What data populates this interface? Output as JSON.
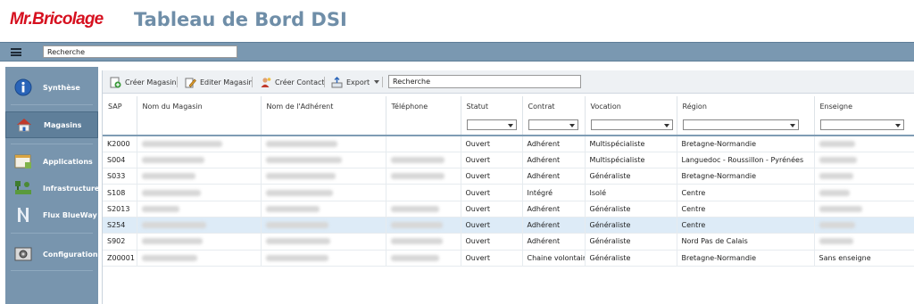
{
  "header": {
    "logo": "Mr.Bricolage",
    "title": "Tableau de Bord DSI"
  },
  "topbar": {
    "search_value": "Recherche"
  },
  "sidebar": {
    "items": [
      {
        "label": "Synthèse",
        "icon": "info-icon"
      },
      {
        "label": "Magasins",
        "icon": "home-icon",
        "active": true
      },
      {
        "label": "Applications",
        "icon": "window-icon"
      },
      {
        "label": "Infrastructure",
        "icon": "network-icon"
      },
      {
        "label": "Flux BlueWay",
        "icon": "flow-icon"
      },
      {
        "label": "Configuration",
        "icon": "settings-icon"
      }
    ]
  },
  "toolbar": {
    "create_store": "Créer Magasin",
    "edit_store": "Editer Magasin",
    "create_contact": "Créer Contact",
    "export": "Export",
    "search_value": "Recherche"
  },
  "table": {
    "columns": [
      "SAP",
      "Nom du Magasin",
      "Nom de l'Adhérent",
      "Téléphone",
      "Statut",
      "Contrat",
      "Vocation",
      "Région",
      "Enseigne"
    ],
    "rows": [
      {
        "sap": "K2000",
        "statut": "Ouvert",
        "contrat": "Adhérent",
        "vocation": "Multispécialiste",
        "region": "Bretagne-Normandie",
        "enseigne": ""
      },
      {
        "sap": "S004",
        "statut": "Ouvert",
        "contrat": "Adhérent",
        "vocation": "Multispécialiste",
        "region": "Languedoc - Roussillon - Pyrénées",
        "enseigne": ""
      },
      {
        "sap": "S033",
        "statut": "Ouvert",
        "contrat": "Adhérent",
        "vocation": "Généraliste",
        "region": "Bretagne-Normandie",
        "enseigne": ""
      },
      {
        "sap": "S108",
        "statut": "Ouvert",
        "contrat": "Intégré",
        "vocation": "Isolé",
        "region": "Centre",
        "enseigne": ""
      },
      {
        "sap": "S2013",
        "statut": "Ouvert",
        "contrat": "Adhérent",
        "vocation": "Généraliste",
        "region": "Centre",
        "enseigne": ""
      },
      {
        "sap": "S254",
        "statut": "Ouvert",
        "contrat": "Adhérent",
        "vocation": "Généraliste",
        "region": "Centre",
        "enseigne": "",
        "selected": true
      },
      {
        "sap": "S902",
        "statut": "Ouvert",
        "contrat": "Adhérent",
        "vocation": "Généraliste",
        "region": "Nord Pas de Calais",
        "enseigne": ""
      },
      {
        "sap": "Z00001",
        "statut": "Ouvert",
        "contrat": "Chaine volontaire",
        "vocation": "Généraliste",
        "region": "Bretagne-Normandie",
        "enseigne": "Sans enseigne"
      }
    ]
  },
  "colors": {
    "accent": "#7895ae",
    "brand_red": "#d6101f",
    "title_blue": "#6f8ea8",
    "selected_row": "#ddebf7"
  }
}
